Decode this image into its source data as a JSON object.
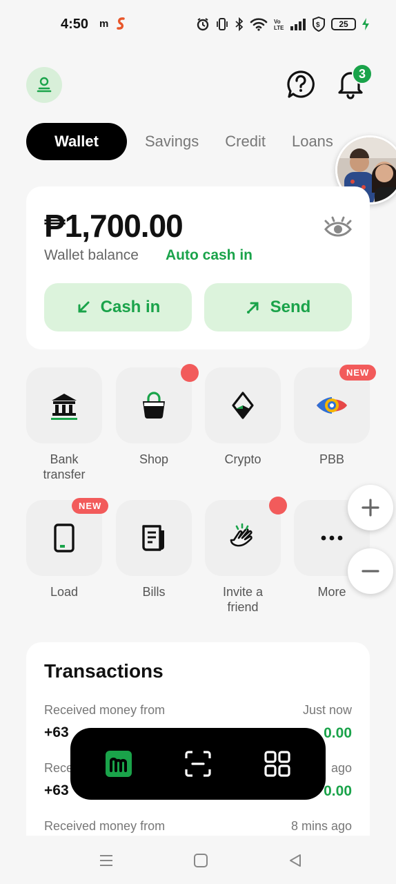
{
  "status_bar": {
    "time": "4:50",
    "app_m": "m",
    "battery": "25"
  },
  "header": {
    "notifications_count": "3"
  },
  "tabs": [
    {
      "label": "Wallet",
      "active": true
    },
    {
      "label": "Savings",
      "active": false
    },
    {
      "label": "Credit",
      "active": false
    },
    {
      "label": "Loans",
      "active": false
    }
  ],
  "wallet": {
    "balance": "₱1,700.00",
    "balance_label": "Wallet balance",
    "auto_cash_in": "Auto cash in",
    "cash_in": "Cash in",
    "send": "Send"
  },
  "services": [
    {
      "label": "Bank transfer",
      "icon": "bank-icon"
    },
    {
      "label": "Shop",
      "icon": "shopping-bag-icon",
      "dot": true
    },
    {
      "label": "Crypto",
      "icon": "crypto-icon"
    },
    {
      "label": "PBB",
      "icon": "pbb-eye-icon",
      "badge": "NEW"
    },
    {
      "label": "Load",
      "icon": "phone-icon",
      "badge": "NEW"
    },
    {
      "label": "Bills",
      "icon": "bill-icon"
    },
    {
      "label": "Invite a friend",
      "icon": "clapping-hands-icon",
      "dot": true
    },
    {
      "label": "More",
      "icon": "more-dots-icon"
    }
  ],
  "transactions": {
    "title": "Transactions",
    "items": [
      {
        "desc": "Received money from",
        "when": "Just now",
        "number": "+63",
        "amount": "0.00"
      },
      {
        "desc": "Rece",
        "when": "ago",
        "number": "+63",
        "amount": "0.00"
      },
      {
        "desc": "Received money from",
        "when": "8 mins ago"
      }
    ]
  },
  "colors": {
    "brand_green": "#1aa34a",
    "light_green": "#dcf3dc",
    "badge_red": "#f25b5b"
  }
}
